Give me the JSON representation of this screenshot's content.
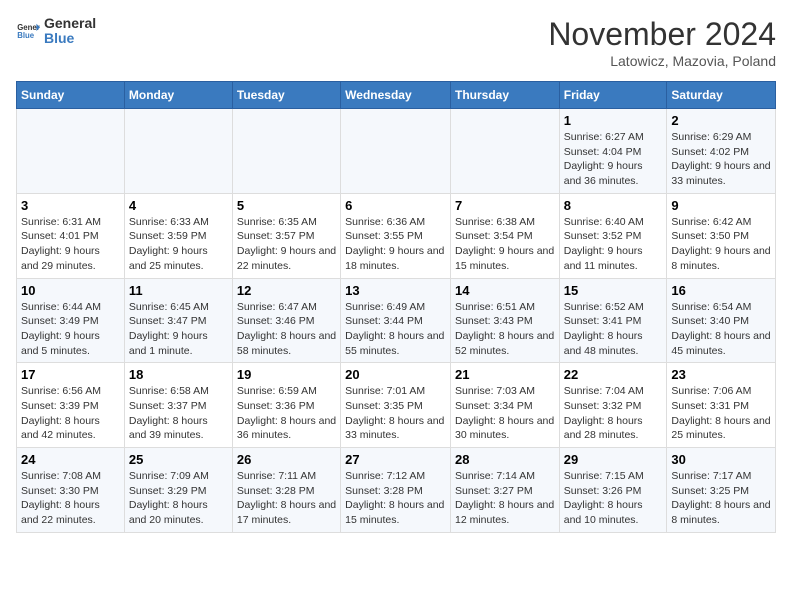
{
  "logo": {
    "text_general": "General",
    "text_blue": "Blue"
  },
  "header": {
    "month_title": "November 2024",
    "subtitle": "Latowicz, Mazovia, Poland"
  },
  "days_of_week": [
    "Sunday",
    "Monday",
    "Tuesday",
    "Wednesday",
    "Thursday",
    "Friday",
    "Saturday"
  ],
  "weeks": [
    [
      {
        "day": "",
        "info": ""
      },
      {
        "day": "",
        "info": ""
      },
      {
        "day": "",
        "info": ""
      },
      {
        "day": "",
        "info": ""
      },
      {
        "day": "",
        "info": ""
      },
      {
        "day": "1",
        "info": "Sunrise: 6:27 AM\nSunset: 4:04 PM\nDaylight: 9 hours and 36 minutes."
      },
      {
        "day": "2",
        "info": "Sunrise: 6:29 AM\nSunset: 4:02 PM\nDaylight: 9 hours and 33 minutes."
      }
    ],
    [
      {
        "day": "3",
        "info": "Sunrise: 6:31 AM\nSunset: 4:01 PM\nDaylight: 9 hours and 29 minutes."
      },
      {
        "day": "4",
        "info": "Sunrise: 6:33 AM\nSunset: 3:59 PM\nDaylight: 9 hours and 25 minutes."
      },
      {
        "day": "5",
        "info": "Sunrise: 6:35 AM\nSunset: 3:57 PM\nDaylight: 9 hours and 22 minutes."
      },
      {
        "day": "6",
        "info": "Sunrise: 6:36 AM\nSunset: 3:55 PM\nDaylight: 9 hours and 18 minutes."
      },
      {
        "day": "7",
        "info": "Sunrise: 6:38 AM\nSunset: 3:54 PM\nDaylight: 9 hours and 15 minutes."
      },
      {
        "day": "8",
        "info": "Sunrise: 6:40 AM\nSunset: 3:52 PM\nDaylight: 9 hours and 11 minutes."
      },
      {
        "day": "9",
        "info": "Sunrise: 6:42 AM\nSunset: 3:50 PM\nDaylight: 9 hours and 8 minutes."
      }
    ],
    [
      {
        "day": "10",
        "info": "Sunrise: 6:44 AM\nSunset: 3:49 PM\nDaylight: 9 hours and 5 minutes."
      },
      {
        "day": "11",
        "info": "Sunrise: 6:45 AM\nSunset: 3:47 PM\nDaylight: 9 hours and 1 minute."
      },
      {
        "day": "12",
        "info": "Sunrise: 6:47 AM\nSunset: 3:46 PM\nDaylight: 8 hours and 58 minutes."
      },
      {
        "day": "13",
        "info": "Sunrise: 6:49 AM\nSunset: 3:44 PM\nDaylight: 8 hours and 55 minutes."
      },
      {
        "day": "14",
        "info": "Sunrise: 6:51 AM\nSunset: 3:43 PM\nDaylight: 8 hours and 52 minutes."
      },
      {
        "day": "15",
        "info": "Sunrise: 6:52 AM\nSunset: 3:41 PM\nDaylight: 8 hours and 48 minutes."
      },
      {
        "day": "16",
        "info": "Sunrise: 6:54 AM\nSunset: 3:40 PM\nDaylight: 8 hours and 45 minutes."
      }
    ],
    [
      {
        "day": "17",
        "info": "Sunrise: 6:56 AM\nSunset: 3:39 PM\nDaylight: 8 hours and 42 minutes."
      },
      {
        "day": "18",
        "info": "Sunrise: 6:58 AM\nSunset: 3:37 PM\nDaylight: 8 hours and 39 minutes."
      },
      {
        "day": "19",
        "info": "Sunrise: 6:59 AM\nSunset: 3:36 PM\nDaylight: 8 hours and 36 minutes."
      },
      {
        "day": "20",
        "info": "Sunrise: 7:01 AM\nSunset: 3:35 PM\nDaylight: 8 hours and 33 minutes."
      },
      {
        "day": "21",
        "info": "Sunrise: 7:03 AM\nSunset: 3:34 PM\nDaylight: 8 hours and 30 minutes."
      },
      {
        "day": "22",
        "info": "Sunrise: 7:04 AM\nSunset: 3:32 PM\nDaylight: 8 hours and 28 minutes."
      },
      {
        "day": "23",
        "info": "Sunrise: 7:06 AM\nSunset: 3:31 PM\nDaylight: 8 hours and 25 minutes."
      }
    ],
    [
      {
        "day": "24",
        "info": "Sunrise: 7:08 AM\nSunset: 3:30 PM\nDaylight: 8 hours and 22 minutes."
      },
      {
        "day": "25",
        "info": "Sunrise: 7:09 AM\nSunset: 3:29 PM\nDaylight: 8 hours and 20 minutes."
      },
      {
        "day": "26",
        "info": "Sunrise: 7:11 AM\nSunset: 3:28 PM\nDaylight: 8 hours and 17 minutes."
      },
      {
        "day": "27",
        "info": "Sunrise: 7:12 AM\nSunset: 3:28 PM\nDaylight: 8 hours and 15 minutes."
      },
      {
        "day": "28",
        "info": "Sunrise: 7:14 AM\nSunset: 3:27 PM\nDaylight: 8 hours and 12 minutes."
      },
      {
        "day": "29",
        "info": "Sunrise: 7:15 AM\nSunset: 3:26 PM\nDaylight: 8 hours and 10 minutes."
      },
      {
        "day": "30",
        "info": "Sunrise: 7:17 AM\nSunset: 3:25 PM\nDaylight: 8 hours and 8 minutes."
      }
    ]
  ]
}
